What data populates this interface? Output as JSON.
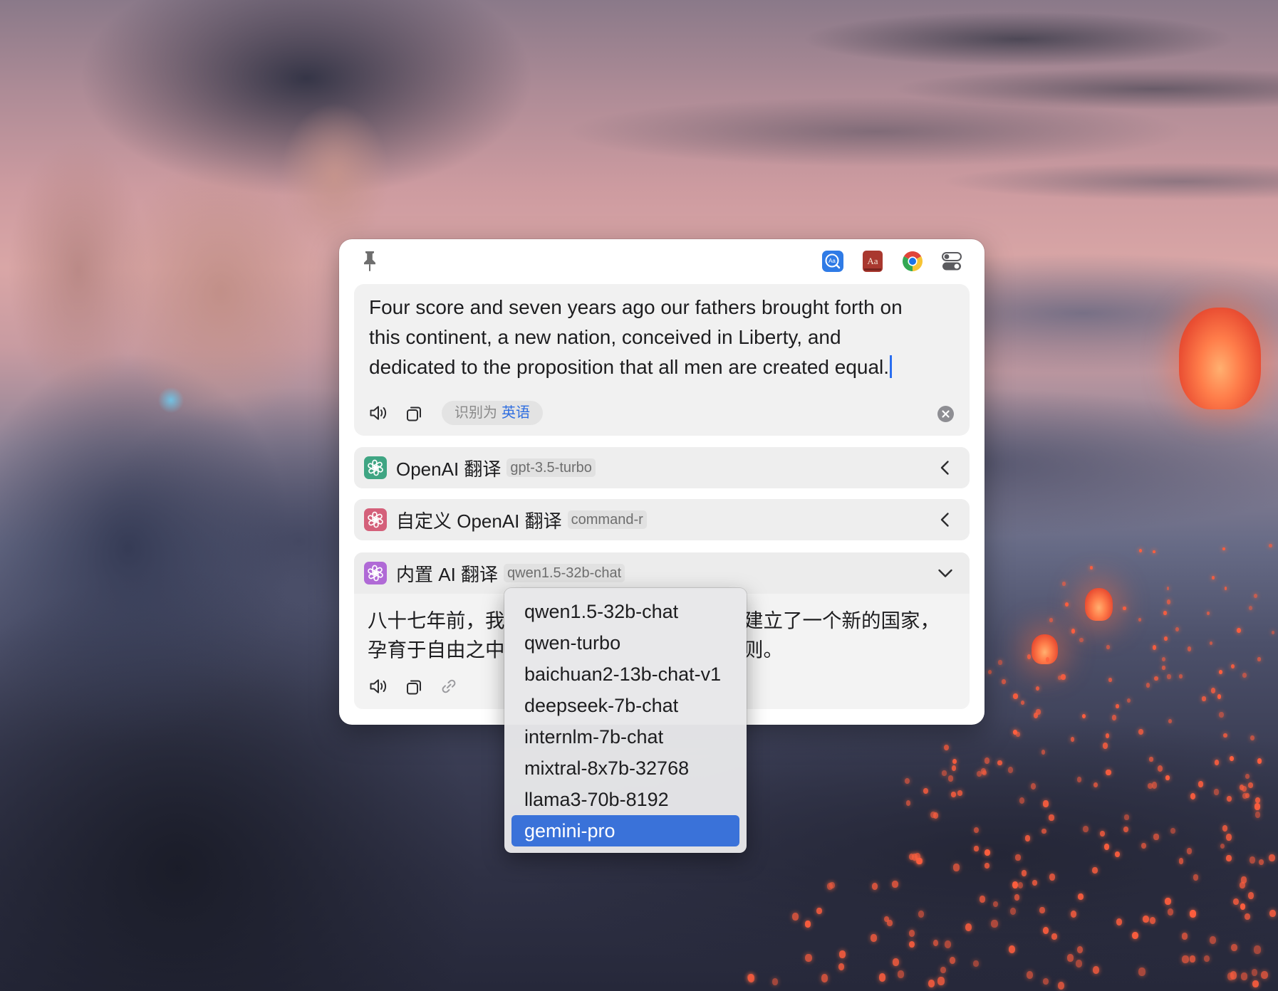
{
  "app": {
    "pin_icon": "pin-icon",
    "toolbar_icons": [
      {
        "name": "dictionary-lookup-icon",
        "glyph": "Aa",
        "color": "#2f7be6"
      },
      {
        "name": "apple-dictionary-icon",
        "glyph": "Aa",
        "color": "#a9382f"
      },
      {
        "name": "chrome-icon"
      },
      {
        "name": "settings-toggles-icon"
      }
    ]
  },
  "source": {
    "lines": [
      "Four score and seven years ago our fathers brought forth on",
      "this continent, a new nation, conceived in Liberty, and",
      "dedicated to the proposition that all men are created equal."
    ],
    "detected_label": "识别为",
    "detected_language": "英语",
    "actions": [
      "speaker-icon",
      "copy-icon",
      "clear-icon"
    ]
  },
  "services": [
    {
      "name": "OpenAI 翻译",
      "model": "gpt-3.5-turbo",
      "icon": "openai-logo-icon",
      "icon_color": "#3fa583",
      "expanded": false,
      "chevron": "chevron-left-icon"
    },
    {
      "name": "自定义 OpenAI 翻译",
      "model": "command-r",
      "icon": "openai-logo-icon",
      "icon_color": "#d4607a",
      "expanded": false,
      "chevron": "chevron-left-icon"
    },
    {
      "name": "内置 AI 翻译",
      "model": "qwen1.5-32b-chat",
      "icon": "openai-logo-icon",
      "icon_color": "#b06ad6",
      "expanded": true,
      "chevron": "chevron-down-icon",
      "result": {
        "line1_left": "八十七年前，我",
        "line1_right": "建立了一个新的国家，",
        "line2_left": "孕育于自由之中",
        "line2_right": "则。"
      },
      "actions": [
        "speaker-icon",
        "copy-icon",
        "link-icon"
      ]
    }
  ],
  "model_menu": {
    "options": [
      "qwen1.5-32b-chat",
      "qwen-turbo",
      "baichuan2-13b-chat-v1",
      "deepseek-7b-chat",
      "internlm-7b-chat",
      "mixtral-8x7b-32768",
      "llama3-70b-8192",
      "gemini-pro"
    ],
    "selected_index": 7
  },
  "colors": {
    "accent": "#3a72d9",
    "detected_language": "#2f6ee0",
    "caret": "#2a6ef0"
  }
}
